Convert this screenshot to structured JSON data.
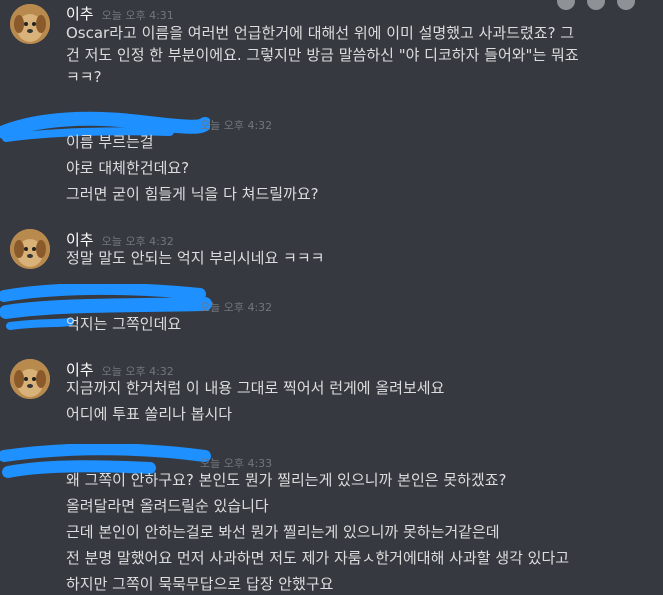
{
  "colors": {
    "background": "#36393f",
    "text": "#dcddde",
    "username": "#ffffff",
    "timestamp": "#72767d",
    "redaction": "#1e90ff"
  },
  "toolbar": {
    "icons": [
      "reaction-icon",
      "edit-icon",
      "more-icon"
    ]
  },
  "messages": [
    {
      "author": "이추",
      "timestamp": "오늘 오후 4:31",
      "lines": [
        "Oscar라고 이름을 여러번 언급한거에 대해선 위에 이미 설명했고 사과드렸죠? 그",
        "건 저도 인정 한 부분이에요. 그렇지만 방금 말씀하신 \"야 디코하자 들어와\"는 뭐죠",
        "ㅋㅋ?"
      ]
    },
    {
      "author_redacted": true,
      "timestamp": "오늘 오후 4:32",
      "lines": [
        "이름 부르는걸",
        "야로 대체한건데요?",
        "그러면 굳이 힘들게 닉을 다 쳐드릴까요?"
      ]
    },
    {
      "author": "이추",
      "timestamp": "오늘 오후 4:32",
      "lines": [
        "정말 말도 안되는 억지 부리시네요 ㅋㅋㅋ"
      ]
    },
    {
      "author_redacted": true,
      "timestamp": "오늘 오후 4:32",
      "lines": [
        "억지는 그쪽인데요"
      ]
    },
    {
      "author": "이추",
      "timestamp": "오늘 오후 4:32",
      "lines": [
        "지금까지 한거처럼 이 내용 그대로 찍어서 런게에 올려보세요",
        "어디에 투표 쏠리나 봅시다"
      ]
    },
    {
      "author_redacted": true,
      "timestamp": "오늘 오후 4:33",
      "lines": [
        "왜 그쪽이 안하구요? 본인도 뭔가 찔리는게 있으니까 본인은 못하겠죠?",
        "올려달라면 올려드릴순 있습니다",
        "근데 본인이 안하는걸로 봐선 뭔가 찔리는게 있으니까 못하는거같은데",
        "전 분명 말했어요 먼저 사과하면 저도 제가 자룸ㅅ한거에대해 사과할 생각 있다고",
        "하지만 그쪽이 묵묵무답으로 답장 안했구요"
      ]
    }
  ]
}
